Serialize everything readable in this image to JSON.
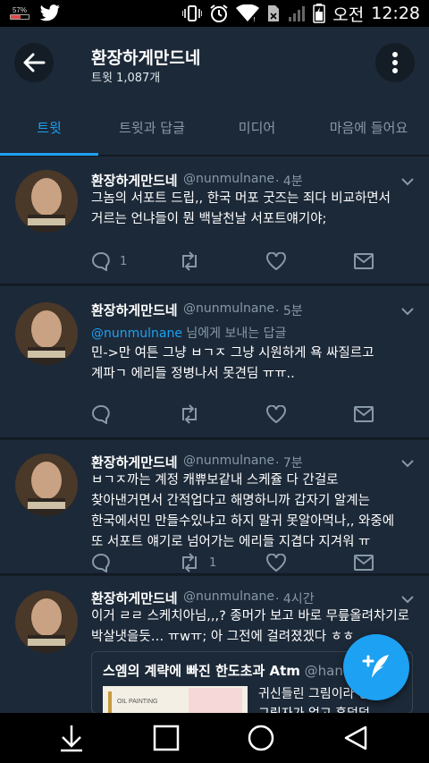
{
  "status_bar": {
    "battery_small_pct": "57%",
    "carrier_time_label": "오전",
    "time": "12:28",
    "icons": [
      "twitter-bird-icon",
      "vibrate-icon",
      "alarm-icon",
      "wifi-icon",
      "no-sim-icon",
      "signal-icon",
      "battery-icon"
    ]
  },
  "header": {
    "title": "환장하게만드네",
    "subtitle": "트윗 1,087개"
  },
  "tabs": [
    {
      "label": "트윗",
      "active": true
    },
    {
      "label": "트윗과 답글",
      "active": false
    },
    {
      "label": "미디어",
      "active": false
    },
    {
      "label": "마음에 들어요",
      "active": false
    }
  ],
  "tweets": [
    {
      "name": "환장하게만드네",
      "handle": "@nunmulnane",
      "time": "· 4분",
      "text": "그놈의 서포트 드립,, 한국 머포 굿즈는 죄다 비교하면서\n거르는 언냐들이 뭔 백날천날 서포트얘기야;",
      "reply_count": "1",
      "retweet_count": ""
    },
    {
      "name": "환장하게만드네",
      "handle": "@nunmulnane",
      "time": "· 5분",
      "reply_to_mention": "@nunmulnane",
      "reply_to_suffix": " 님에게 보내는 답글",
      "text": "민->만 여튼 그냥 ㅂㄱㅈ 그냥 시원하게 욕 싸질르고\n계파ㄱ 에리들 정병나서 못견딤 ㅠㅠ..",
      "reply_count": "",
      "retweet_count": ""
    },
    {
      "name": "환장하게만드네",
      "handle": "@nunmulnane",
      "time": "· 7분",
      "text": "ㅂㄱㅈ까는 계정 캐쀼보같내 스케쥴 다 간걸로\n찾아낸거면서 간적업다고 해명하니까 갑자기 알계는\n한국에서민 만들수있냐고 하지 말귀 못알아먹나,, 와중에\n또 서포트 얘기로 넘어가는 에리들 지겹다 지겨워 ㅠ",
      "reply_count": "",
      "retweet_count": "1"
    },
    {
      "name": "환장하게만드네",
      "handle": "@nunmulnane",
      "time": "· 4시간",
      "text": "이거 ㄹㄹ 스케치아님,,,? 종머가 보고 바로 무릎올려차기로\n박살냇을듯… ㅠwㅠ; 아 그전에 걸려졌겠다 ㅎㅎ",
      "reply_count": "",
      "retweet_count": ""
    }
  ],
  "quoted_card": {
    "title": "스엠의 계략에 빠진 한도초과 Atm",
    "handle": " @hando",
    "text": "귀신들린 그림이라 상에\n그림자가 없고 훈덜덜",
    "image_caption": "OIL PAINTING"
  },
  "fab": {
    "icon": "compose-tweet-icon"
  },
  "nav": [
    "download-icon",
    "square-icon",
    "circle-icon",
    "back-triangle-icon"
  ],
  "colors": {
    "background": "#141d26",
    "card": "#1c2938",
    "accent": "#1da1f2",
    "muted": "#8899a6"
  }
}
